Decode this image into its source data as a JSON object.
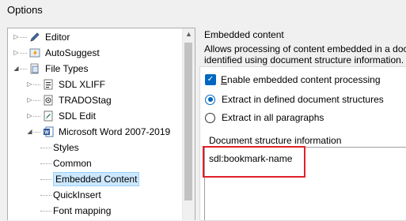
{
  "window": {
    "title": "Options"
  },
  "tree": {
    "items": [
      {
        "label": "Editor",
        "icon": "pencil-icon",
        "expander": "▷",
        "level": 0
      },
      {
        "label": "AutoSuggest",
        "icon": "lightning-icon",
        "expander": "▷",
        "level": 0
      },
      {
        "label": "File Types",
        "icon": "file-types-icon",
        "expander": "◢",
        "level": 0
      },
      {
        "label": "SDL XLIFF",
        "icon": "xliff-icon",
        "expander": "▷",
        "level": 1
      },
      {
        "label": "TRADOStag",
        "icon": "tradostag-icon",
        "expander": "▷",
        "level": 1
      },
      {
        "label": "SDL Edit",
        "icon": "sdl-edit-icon",
        "expander": "▷",
        "level": 1
      },
      {
        "label": "Microsoft Word 2007-2019",
        "icon": "word-icon",
        "expander": "◢",
        "level": 1
      },
      {
        "label": "Styles",
        "level": 2
      },
      {
        "label": "Common",
        "level": 2
      },
      {
        "label": "Embedded Content",
        "level": 2,
        "selected": true
      },
      {
        "label": "QuickInsert",
        "level": 2
      },
      {
        "label": "Font mapping",
        "level": 2
      }
    ]
  },
  "panel": {
    "section_title": "Embedded content",
    "description_line1": "Allows processing of content embedded in a docu",
    "description_line2": "identified using document structure information.",
    "checkbox_enable": {
      "accel": "E",
      "rest": "nable embedded content processing",
      "checked": true
    },
    "radio_defined": {
      "label": "Extract in defined document structures",
      "selected": true
    },
    "radio_all": {
      "label": "Extract in all paragraphs",
      "selected": false
    },
    "structure_title": "Document structure information",
    "structure_entry": "sdl:bookmark-name"
  },
  "colors": {
    "accent": "#0067c0",
    "selection_bg": "#cce8ff",
    "highlight_border": "#e0202a"
  }
}
